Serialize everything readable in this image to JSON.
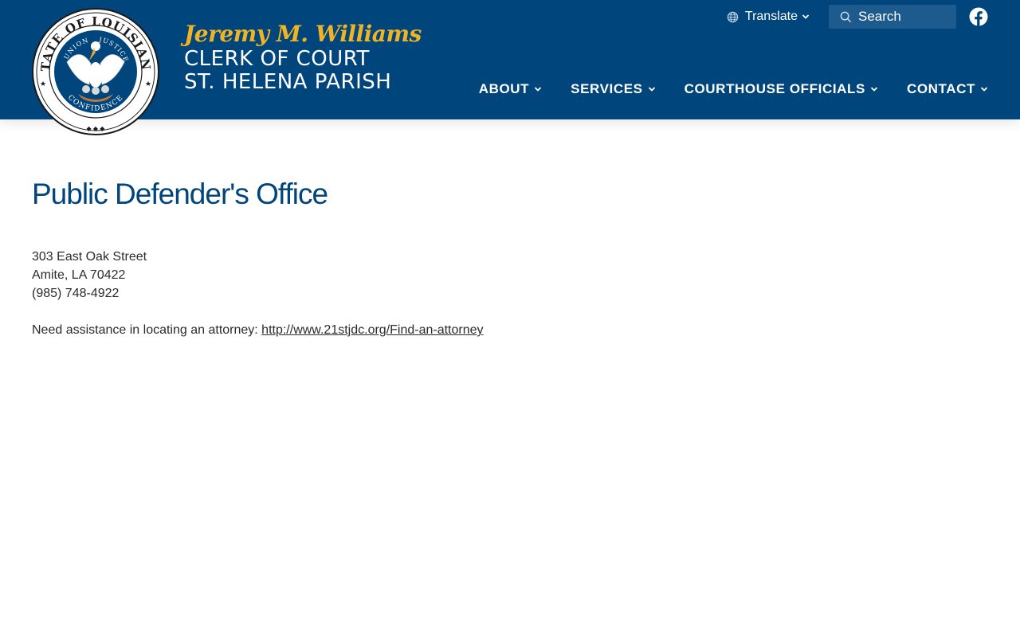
{
  "header": {
    "seal": {
      "top_text": "STATE OF LOUISIANA",
      "inner_left": "UNION",
      "inner_right": "JUSTICE",
      "bottom_text": "CONFIDENCE"
    },
    "brand": {
      "name": "Jeremy M. Williams",
      "line1": "CLERK OF COURT",
      "line2": "ST. HELENA PARISH"
    },
    "utility": {
      "translate_label": "Translate",
      "search_placeholder": "Search",
      "facebook_icon": "facebook-icon"
    },
    "nav": {
      "items": [
        {
          "label": "ABOUT"
        },
        {
          "label": "SERVICES"
        },
        {
          "label": "COURTHOUSE OFFICIALS"
        },
        {
          "label": "CONTACT"
        }
      ]
    }
  },
  "main": {
    "title": "Public Defender's Office",
    "address_line1": "303 East Oak Street",
    "address_line2": "Amite, LA 70422",
    "phone": "(985) 748-4922",
    "assist_text": "Need assistance in locating an attorney: ",
    "assist_link": "http://www.21stjdc.org/Find-an-attorney"
  },
  "colors": {
    "header_bg": "#00457c",
    "brand_gold": "#f0b323",
    "search_bg": "#1d5a8d",
    "title_blue": "#00457c"
  }
}
